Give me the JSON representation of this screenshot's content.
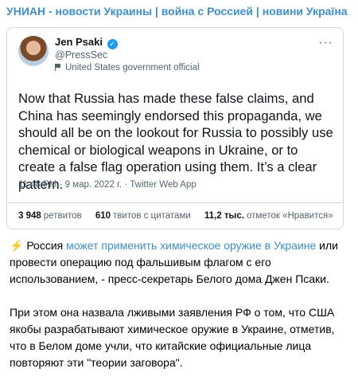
{
  "channel": {
    "title": "УНИАН - новости Украины | война с Россией | новини Україна"
  },
  "tweet": {
    "author": "Jen Psaki",
    "handle": "@PressSec",
    "label": "United States government official",
    "text": "Now that Russia has made these false claims, and China has seemingly endorsed this propaganda, we should all be on the lookout for Russia to possibly use chemical or biological weapons in Ukraine, or to create a false flag operation using them. It’s a clear pattern.",
    "meta": "11:48 PM · 9 мар. 2022 г. · Twitter Web App",
    "stats": {
      "retweets_count": "3 948",
      "retweets_label": "ретвитов",
      "quotes_count": "610",
      "quotes_label": "твитов с цитатами",
      "likes_count": "11,2 тыс.",
      "likes_label": "отметок «Нравится»"
    }
  },
  "post": {
    "lightning": "⚡️",
    "p1_before": " Россия ",
    "p1_link": "может применить химическое оружие в Украине",
    "p1_after": " или провести операцию под фальшивым флагом с его использованием, - пресс-секретарь Белого дома Джен Псаки.",
    "p2": "При этом она назвала лживыми заявления РФ о том, что США якобы разрабатывают химическое оружие в Украине, отметив, что в Белом доме учли, что китайские официальные лица повторяют эти \"теории заговора\"."
  }
}
